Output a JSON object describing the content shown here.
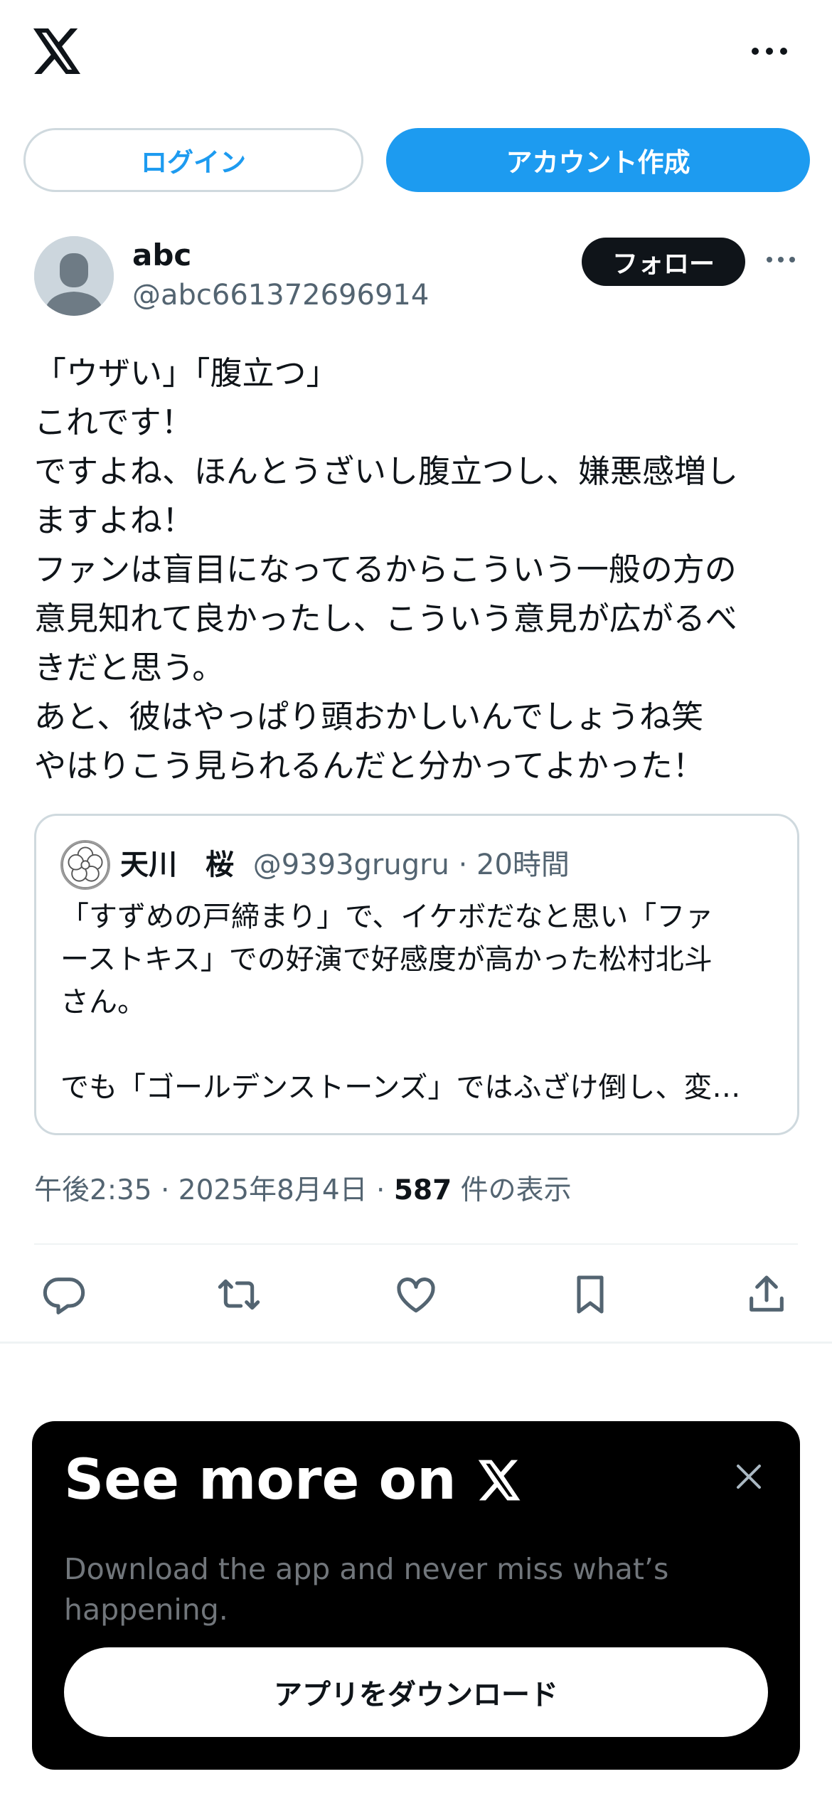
{
  "header": {
    "logo_icon": "x-logo-icon",
    "more_icon": "more-dots-icon"
  },
  "auth": {
    "login_label": "ログイン",
    "signup_label": "アカウント作成"
  },
  "tweet": {
    "display_name": "abc",
    "handle": "@abc661372696914",
    "follow_label": "フォロー",
    "text": "「ウザい」「腹立つ」\nこれです！\nですよね、ほんとうざいし腹立つし、嫌悪感増し\nますよね！\nファンは盲目になってるからこういう一般の方の\n意見知れて良かったし、こういう意見が広がるべ\nきだと思う。\nあと、彼はやっぱり頭おかしいんでしょうね笑\nやはりこう見られるんだと分かってよかった！",
    "quote": {
      "name": "天川　桜",
      "handle_time": "@9393grugru · 20時間",
      "text": "「すずめの戸締まり」で、イケボだなと思い「ファ\nーストキス」での好演で好感度が高かった松村北斗\nさん。\n\nでも「ゴールデンストーンズ」ではふざけ倒し、変…"
    },
    "time_date": "午後2:35 · 2025年8月4日 · ",
    "views_count": "587",
    "views_label": " 件の表示"
  },
  "actions": [
    "reply-icon",
    "retweet-icon",
    "like-icon",
    "bookmark-icon",
    "share-icon"
  ],
  "promo": {
    "title": "See more on",
    "subtitle": "Download the app and never miss what’s happening.",
    "download_label": "アプリをダウンロード"
  },
  "colors": {
    "accent": "#1d9bf0",
    "text": "#0f1419",
    "muted": "#536471",
    "border": "#cfd9de"
  }
}
